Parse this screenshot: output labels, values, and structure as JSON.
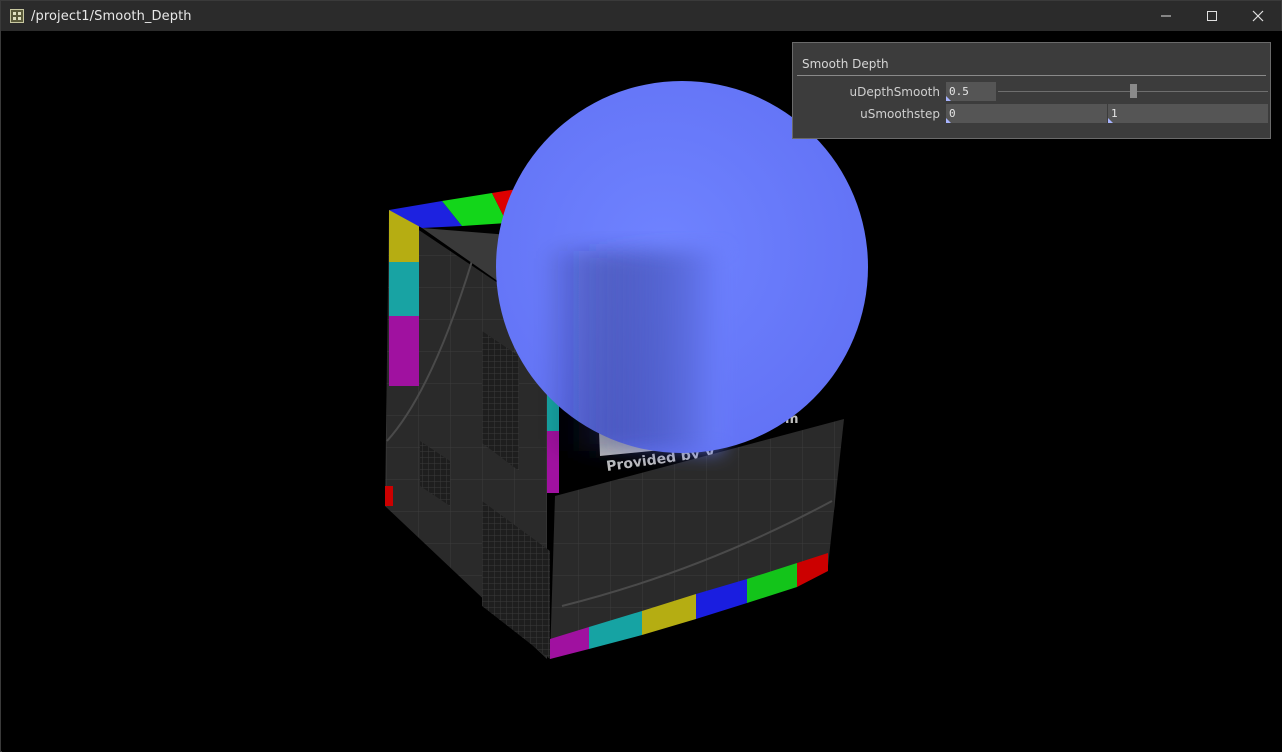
{
  "window": {
    "title": "/project1/Smooth_Depth",
    "icons": {
      "app": "touchdesigner-app-icon",
      "minimize": "minimize-icon",
      "maximize": "maximize-icon",
      "close": "close-icon"
    }
  },
  "panel": {
    "title": "Smooth Depth",
    "params": [
      {
        "label": "uDepthSmooth",
        "value": "0.5",
        "slider_fraction": 0.5
      },
      {
        "label": "uSmoothstep",
        "value_min": "0",
        "value_max": "1"
      }
    ]
  },
  "scene": {
    "cube_text": "Provided by V",
    "cube_text_right": "m",
    "sphere_color": "#6b7fff",
    "background": "#000000"
  }
}
